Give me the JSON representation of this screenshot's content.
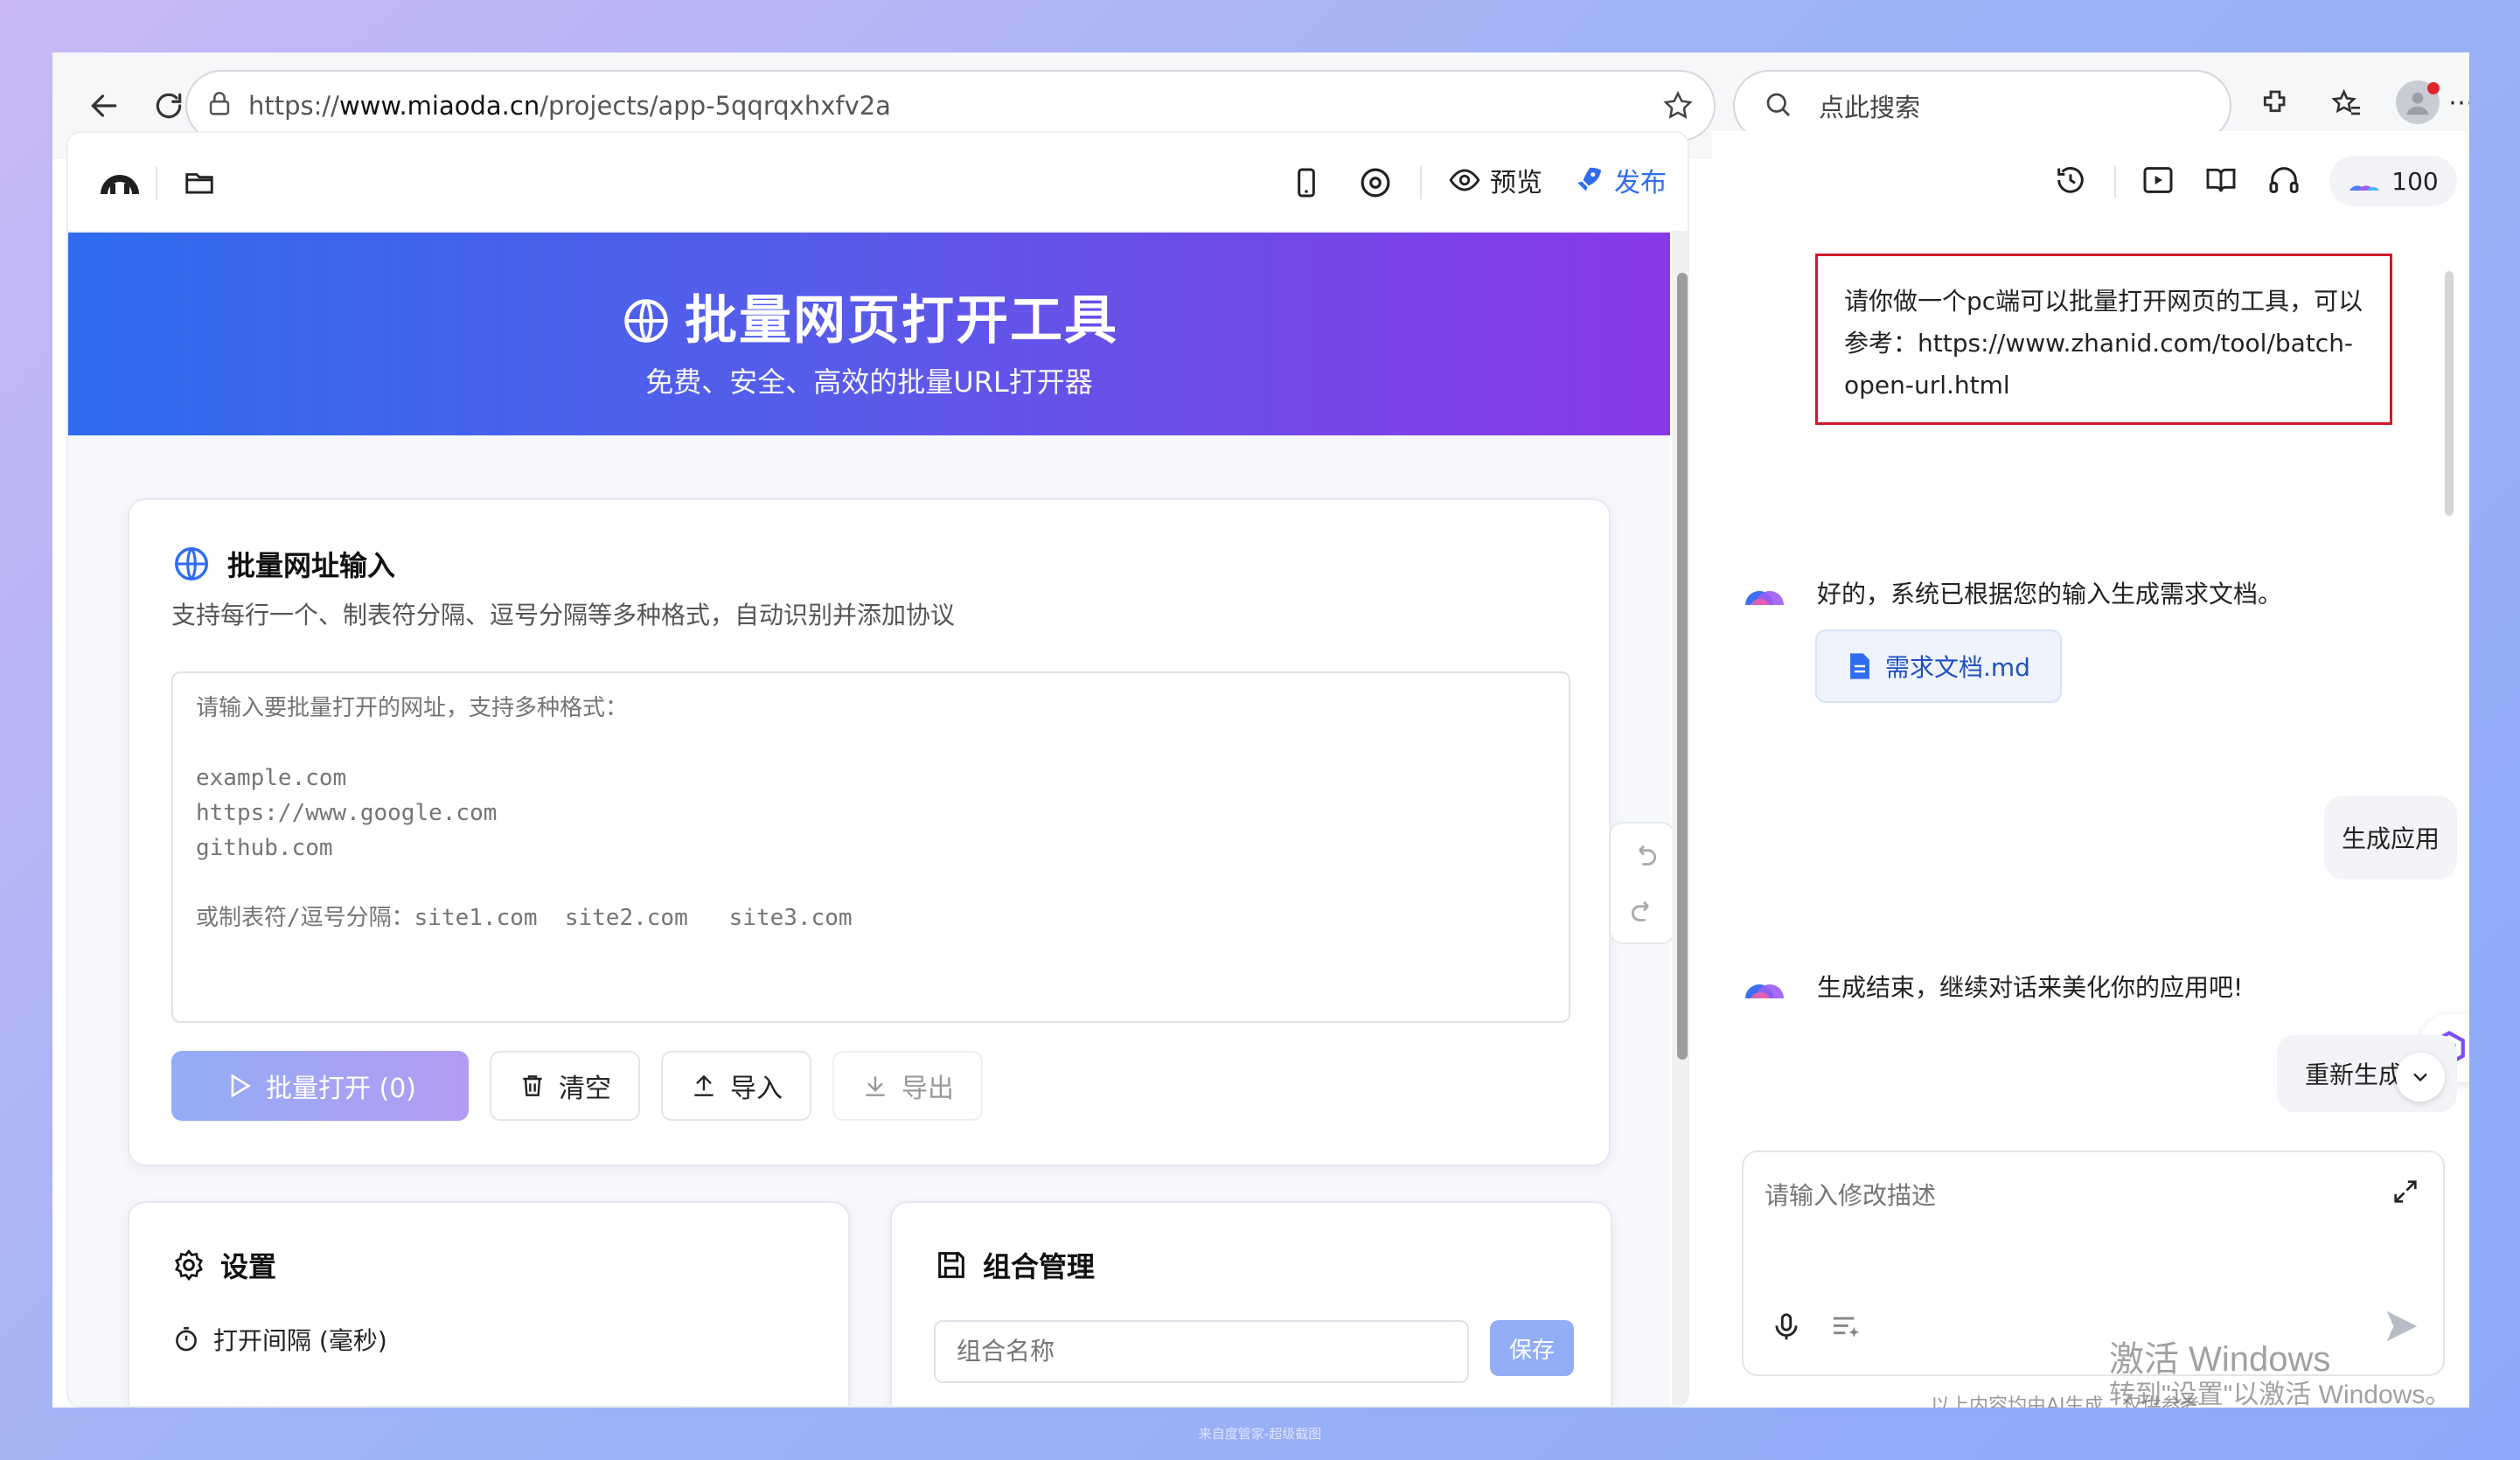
{
  "browser": {
    "url_prefix": "https://",
    "url_host": "www.miaoda.cn",
    "url_path": "/projects/app-5qqrqxhxfv2a",
    "search_placeholder": "点此搜索"
  },
  "app_toolbar": {
    "preview_label": "预览",
    "publish_label": "发布"
  },
  "hero": {
    "title": "批量网页打开工具",
    "subtitle": "免费、安全、高效的批量URL打开器"
  },
  "url_input_card": {
    "title": "批量网址输入",
    "description": "支持每行一个、制表符分隔、逗号分隔等多种格式，自动识别并添加协议",
    "placeholder": "请输入要批量打开的网址，支持多种格式：\n\nexample.com\nhttps://www.google.com\ngithub.com\n\n或制表符/逗号分隔：site1.com  site2.com   site3.com",
    "open_button": "批量打开 (0)",
    "clear_button": "清空",
    "import_button": "导入",
    "export_button": "导出"
  },
  "settings_card": {
    "title": "设置",
    "interval_label": "打开间隔 (毫秒)"
  },
  "combo_card": {
    "title": "组合管理",
    "name_placeholder": "组合名称",
    "save_button": "保存"
  },
  "chat": {
    "credits": "100",
    "user_msg_1": "请你做一个pc端可以批量打开网页的工具，可以参考：https://www.zhanid.com/tool/batch-open-url.html",
    "bot_msg_1": "好的，系统已根据您的输入生成需求文档。",
    "doc_chip": "需求文档.md",
    "user_msg_2": "生成应用",
    "bot_msg_2": "生成结束，继续对话来美化你的应用吧!",
    "regenerate": "重新生成应",
    "input_placeholder": "请输入修改描述",
    "disclaimer": "以上内容均由AI生成，仅供参考"
  },
  "watermark": {
    "line1": "激活 Windows",
    "line2": "转到\"设置\"以激活 Windows。"
  },
  "footer_text": "来自度管家-超级截图",
  "colors": {
    "primary": "#2f6cf0",
    "hero_start": "#2f6cf0",
    "hero_end": "#8a38e9",
    "highlight_border": "#d0192b"
  }
}
